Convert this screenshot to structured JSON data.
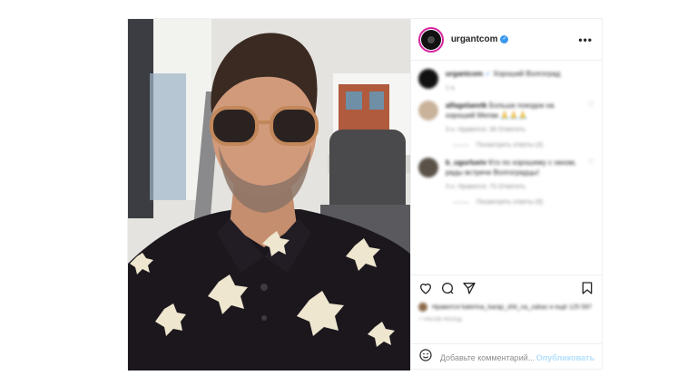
{
  "post": {
    "username": "urgantcom",
    "more_label": "•••",
    "verified_icon": "verified-badge-icon"
  },
  "caption": {
    "username": "urgantcom",
    "text": "Хороший Волгоград",
    "time": "1 н."
  },
  "comments": [
    {
      "username": "alfagelaevtk",
      "text": "Больше поездок на хороший Мепак 🙏🙏🙏",
      "meta": "3 н.   Нравится: 36   Ответить",
      "replies": "Посмотреть ответы (4)",
      "avatar_color": "#c9b29a"
    },
    {
      "username": "b_ugurlueiv",
      "text": "Кто по хорошему с окном, рады встрече Волгоградцы!",
      "meta": "3 н.   Нравится: 75   Ответить",
      "replies": "Посмотреть ответы (8)",
      "avatar_color": "#5a5248"
    }
  ],
  "likes": {
    "text": "Нравится katerina_karap_shit_na_zakaz и ещё 125 597"
  },
  "date": "7 часов назад",
  "add_comment": {
    "placeholder": "Добавьте комментарий...",
    "publish": "Опубликовать"
  }
}
